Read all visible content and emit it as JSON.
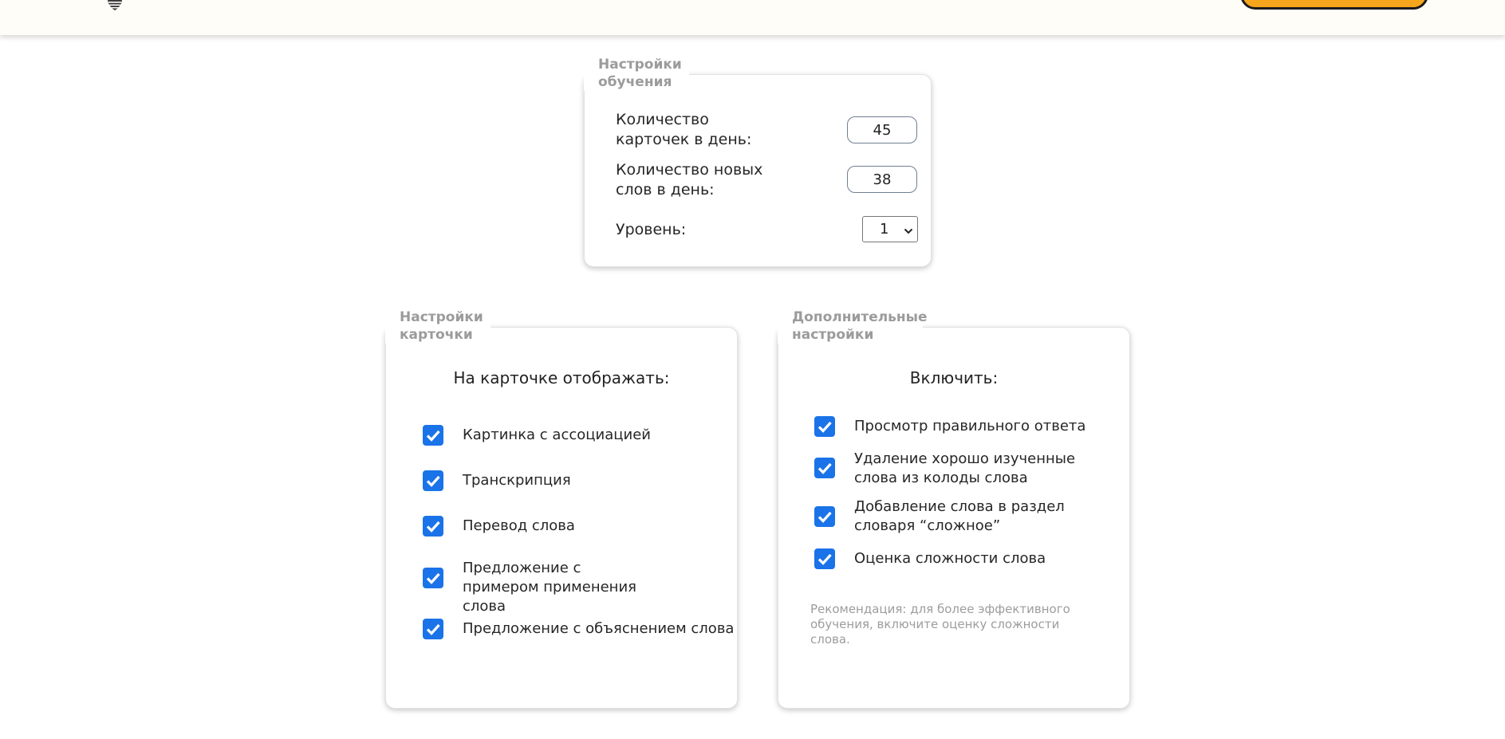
{
  "header": {
    "logo_icon": "bulb-logo-icon",
    "button_color": "#f7a51c"
  },
  "learning": {
    "legend": "Настройки обучения",
    "cards_per_day_label": "Количество карточек в день:",
    "cards_per_day_value": "45",
    "new_words_label": "Количество новых слов в день:",
    "new_words_value": "38",
    "level_label": "Уровень:",
    "level_value": "1"
  },
  "card": {
    "legend": "Настройки карточки",
    "heading": "На карточке отображать:",
    "items": [
      {
        "label": "Картинка с ассоциацией",
        "checked": true
      },
      {
        "label": "Транскрипция",
        "checked": true
      },
      {
        "label": "Перевод слова",
        "checked": true
      },
      {
        "label": "Предложение с примером применения слова",
        "checked": true
      },
      {
        "label": "Предложение с объяснением слова",
        "checked": true
      }
    ]
  },
  "extra": {
    "legend": "Дополнительные настройки",
    "heading": "Включить:",
    "items": [
      {
        "label": "Просмотр правильного ответа",
        "checked": true
      },
      {
        "label": "Удаление хорошо изученные слова из колоды слова",
        "checked": true
      },
      {
        "label": "Добавление слова в раздел словаря “сложное”",
        "checked": true
      },
      {
        "label": "Оценка сложности слова",
        "checked": true
      }
    ],
    "note": "Рекомендация: для более эффективного обучения, включите оценку сложности слова."
  },
  "colors": {
    "accent": "#1a73e8",
    "legend_text": "#9b9b9b",
    "header_bg": "#fffdf8"
  }
}
